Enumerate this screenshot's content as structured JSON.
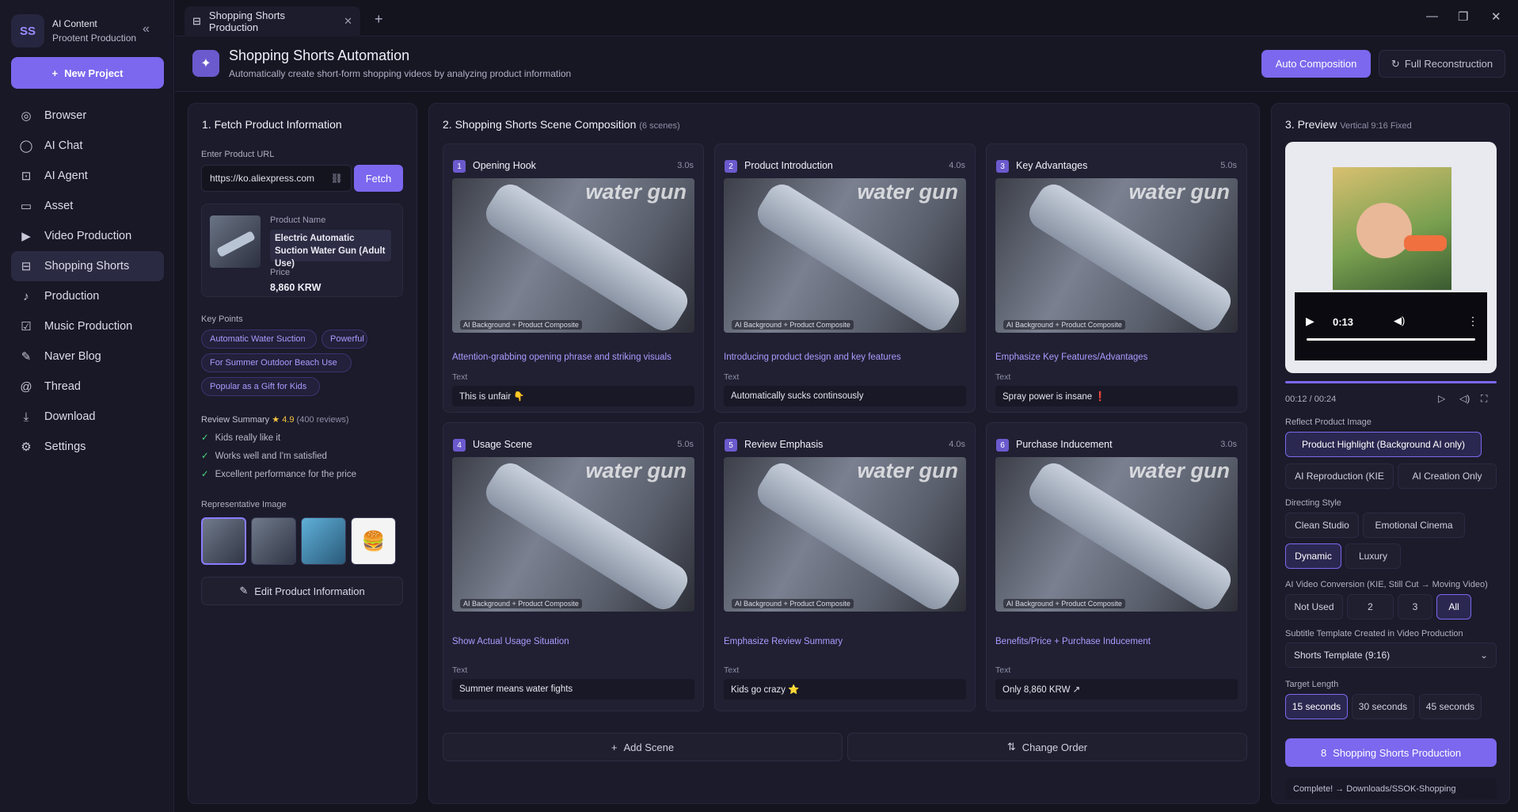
{
  "app": {
    "title": "AI Content",
    "subtitle": "Prootent Production",
    "collapse_icon": "double-chevron-left-icon"
  },
  "sidebar": {
    "new_project": "New Project",
    "items": [
      {
        "label": "Browser",
        "icon": "globe-icon"
      },
      {
        "label": "AI Chat",
        "icon": "chat-icon"
      },
      {
        "label": "AI Agent",
        "icon": "robot-icon"
      },
      {
        "label": "Asset",
        "icon": "folder-icon"
      },
      {
        "label": "Video Production",
        "icon": "video-icon"
      },
      {
        "label": "Shopping Shorts",
        "icon": "shopping-bag-icon",
        "active": true
      },
      {
        "label": "Production",
        "icon": "music-note-icon"
      },
      {
        "label": "Music Production",
        "icon": "music-edit-icon"
      },
      {
        "label": "Naver Blog",
        "icon": "pen-icon"
      },
      {
        "label": "Thread",
        "icon": "at-sign-icon"
      },
      {
        "label": "Download",
        "icon": "download-icon"
      },
      {
        "label": "Settings",
        "icon": "gear-icon"
      }
    ]
  },
  "tabbar": {
    "tab_label": "Shopping Shorts Production"
  },
  "header": {
    "title": "Shopping Shorts Automation",
    "subtitle": "Automatically create short-form shopping videos by analyzing product information",
    "auto_btn": "Auto Composition",
    "full_btn": "Full Reconstruction"
  },
  "fetch": {
    "title": "1. Fetch Product Information",
    "url_label": "Enter Product URL",
    "url_value": "https://ko.aliexpress.com",
    "fetch_btn": "Fetch",
    "product_name_label": "Product Name",
    "product_name": "Electric Automatic Suction Water Gun (Adult Use)",
    "price_label": "Price",
    "price": "8,860 KRW",
    "key_points_label": "Key Points",
    "key_points": [
      "Automatic Water Suction",
      "Powerful",
      "For Summer Outdoor Beach Use",
      "Popular as a Gift for Kids"
    ],
    "review_label": "Review Summary",
    "review_star": "★",
    "review_score": "4.9",
    "review_count": "(400 reviews)",
    "reviews": [
      "Kids really like it",
      "Works well and I'm satisfied",
      "Excellent performance for the price"
    ],
    "rep_image_label": "Representative Image",
    "edit_btn": "Edit Product Information"
  },
  "scenes_panel": {
    "title": "2. Shopping Shorts Scene Composition",
    "count": "(6 scenes)",
    "watermark": "water gun",
    "caption": "AI Background + Product Composite",
    "text_label": "Text",
    "add_btn": "Add Scene",
    "order_btn": "Change Order"
  },
  "scenes": [
    {
      "num": "1",
      "title": "Opening Hook",
      "duration": "3.0s",
      "desc": "Attention-grabbing opening phrase and striking visuals",
      "text": "This is unfair 👇"
    },
    {
      "num": "2",
      "title": "Product Introduction",
      "duration": "4.0s",
      "desc": "Introducing product design and key features",
      "text": "Automatically sucks continsously"
    },
    {
      "num": "3",
      "title": "Key Advantages",
      "duration": "5.0s",
      "desc": "Emphasize Key Features/Advantages",
      "text": "Spray power is insane ❗"
    },
    {
      "num": "4",
      "title": "Usage Scene",
      "duration": "5.0s",
      "desc": "Show Actual Usage Situation",
      "text": "Summer means water fights"
    },
    {
      "num": "5",
      "title": "Review Emphasis",
      "duration": "4.0s",
      "desc": "Emphasize Review Summary",
      "text": "Kids go crazy ⭐"
    },
    {
      "num": "6",
      "title": "Purchase Inducement",
      "duration": "3.0s",
      "desc": "Benefits/Price + Purchase Inducement",
      "text": "Only 8,860 KRW ↗"
    }
  ],
  "preview": {
    "title": "3. Preview",
    "title_note": "Vertical 9:16 Fixed",
    "video_time": "0:13",
    "time_readout": "00:12 / 00:24",
    "reflect_label": "Reflect Product Image",
    "reflect_options": [
      "Product Highlight (Background AI only)",
      "AI Reproduction (KIE",
      "AI Creation Only"
    ],
    "directing_label": "Directing Style",
    "directing_options": [
      "Clean Studio",
      "Emotional Cinema",
      "Dynamic",
      "Luxury"
    ],
    "conversion_label": "AI Video Conversion (KIE, Still Cut → Moving Video)",
    "conversion_options": [
      "Not Used",
      "2",
      "3",
      "All"
    ],
    "template_label": "Subtitle Template Created in Video Production",
    "template_value": "Shorts Template (9:16)",
    "length_label": "Target Length",
    "length_options": [
      "15 seconds",
      "30 seconds",
      "45 seconds"
    ],
    "produce_btn": "Shopping Shorts Production",
    "status": "Complete! → Downloads/SSOK-Shopping"
  }
}
